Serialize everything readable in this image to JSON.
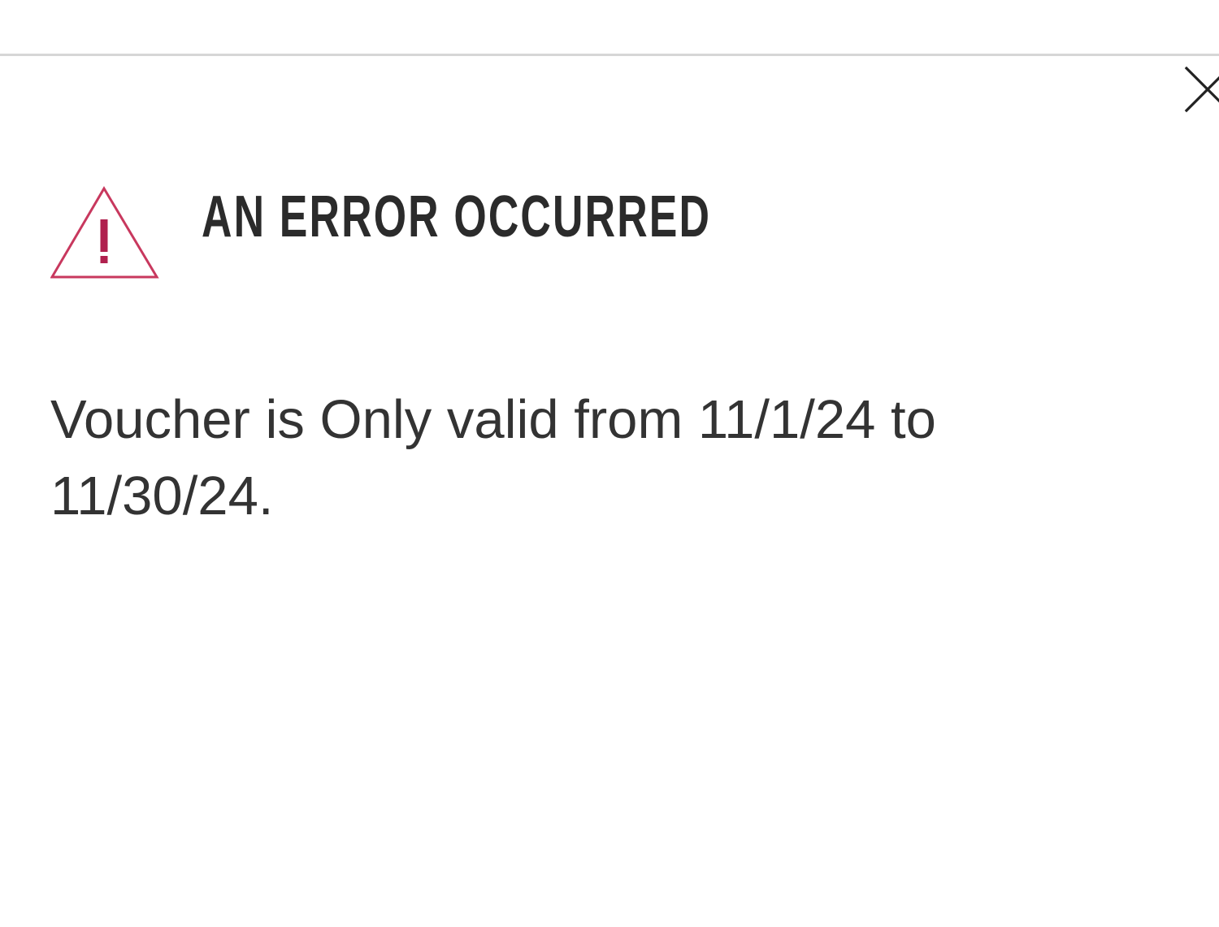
{
  "alert": {
    "title": "AN ERROR OCCURRED",
    "message": "Voucher is Only valid from 11/1/24 to 11/30/24."
  },
  "icons": {
    "close": "close-icon",
    "warning": "warning-triangle-icon"
  },
  "colors": {
    "warning_accent": "#c8385e",
    "title_text": "#2b2b2b",
    "body_text": "#333333",
    "divider": "#d6d6d6"
  }
}
